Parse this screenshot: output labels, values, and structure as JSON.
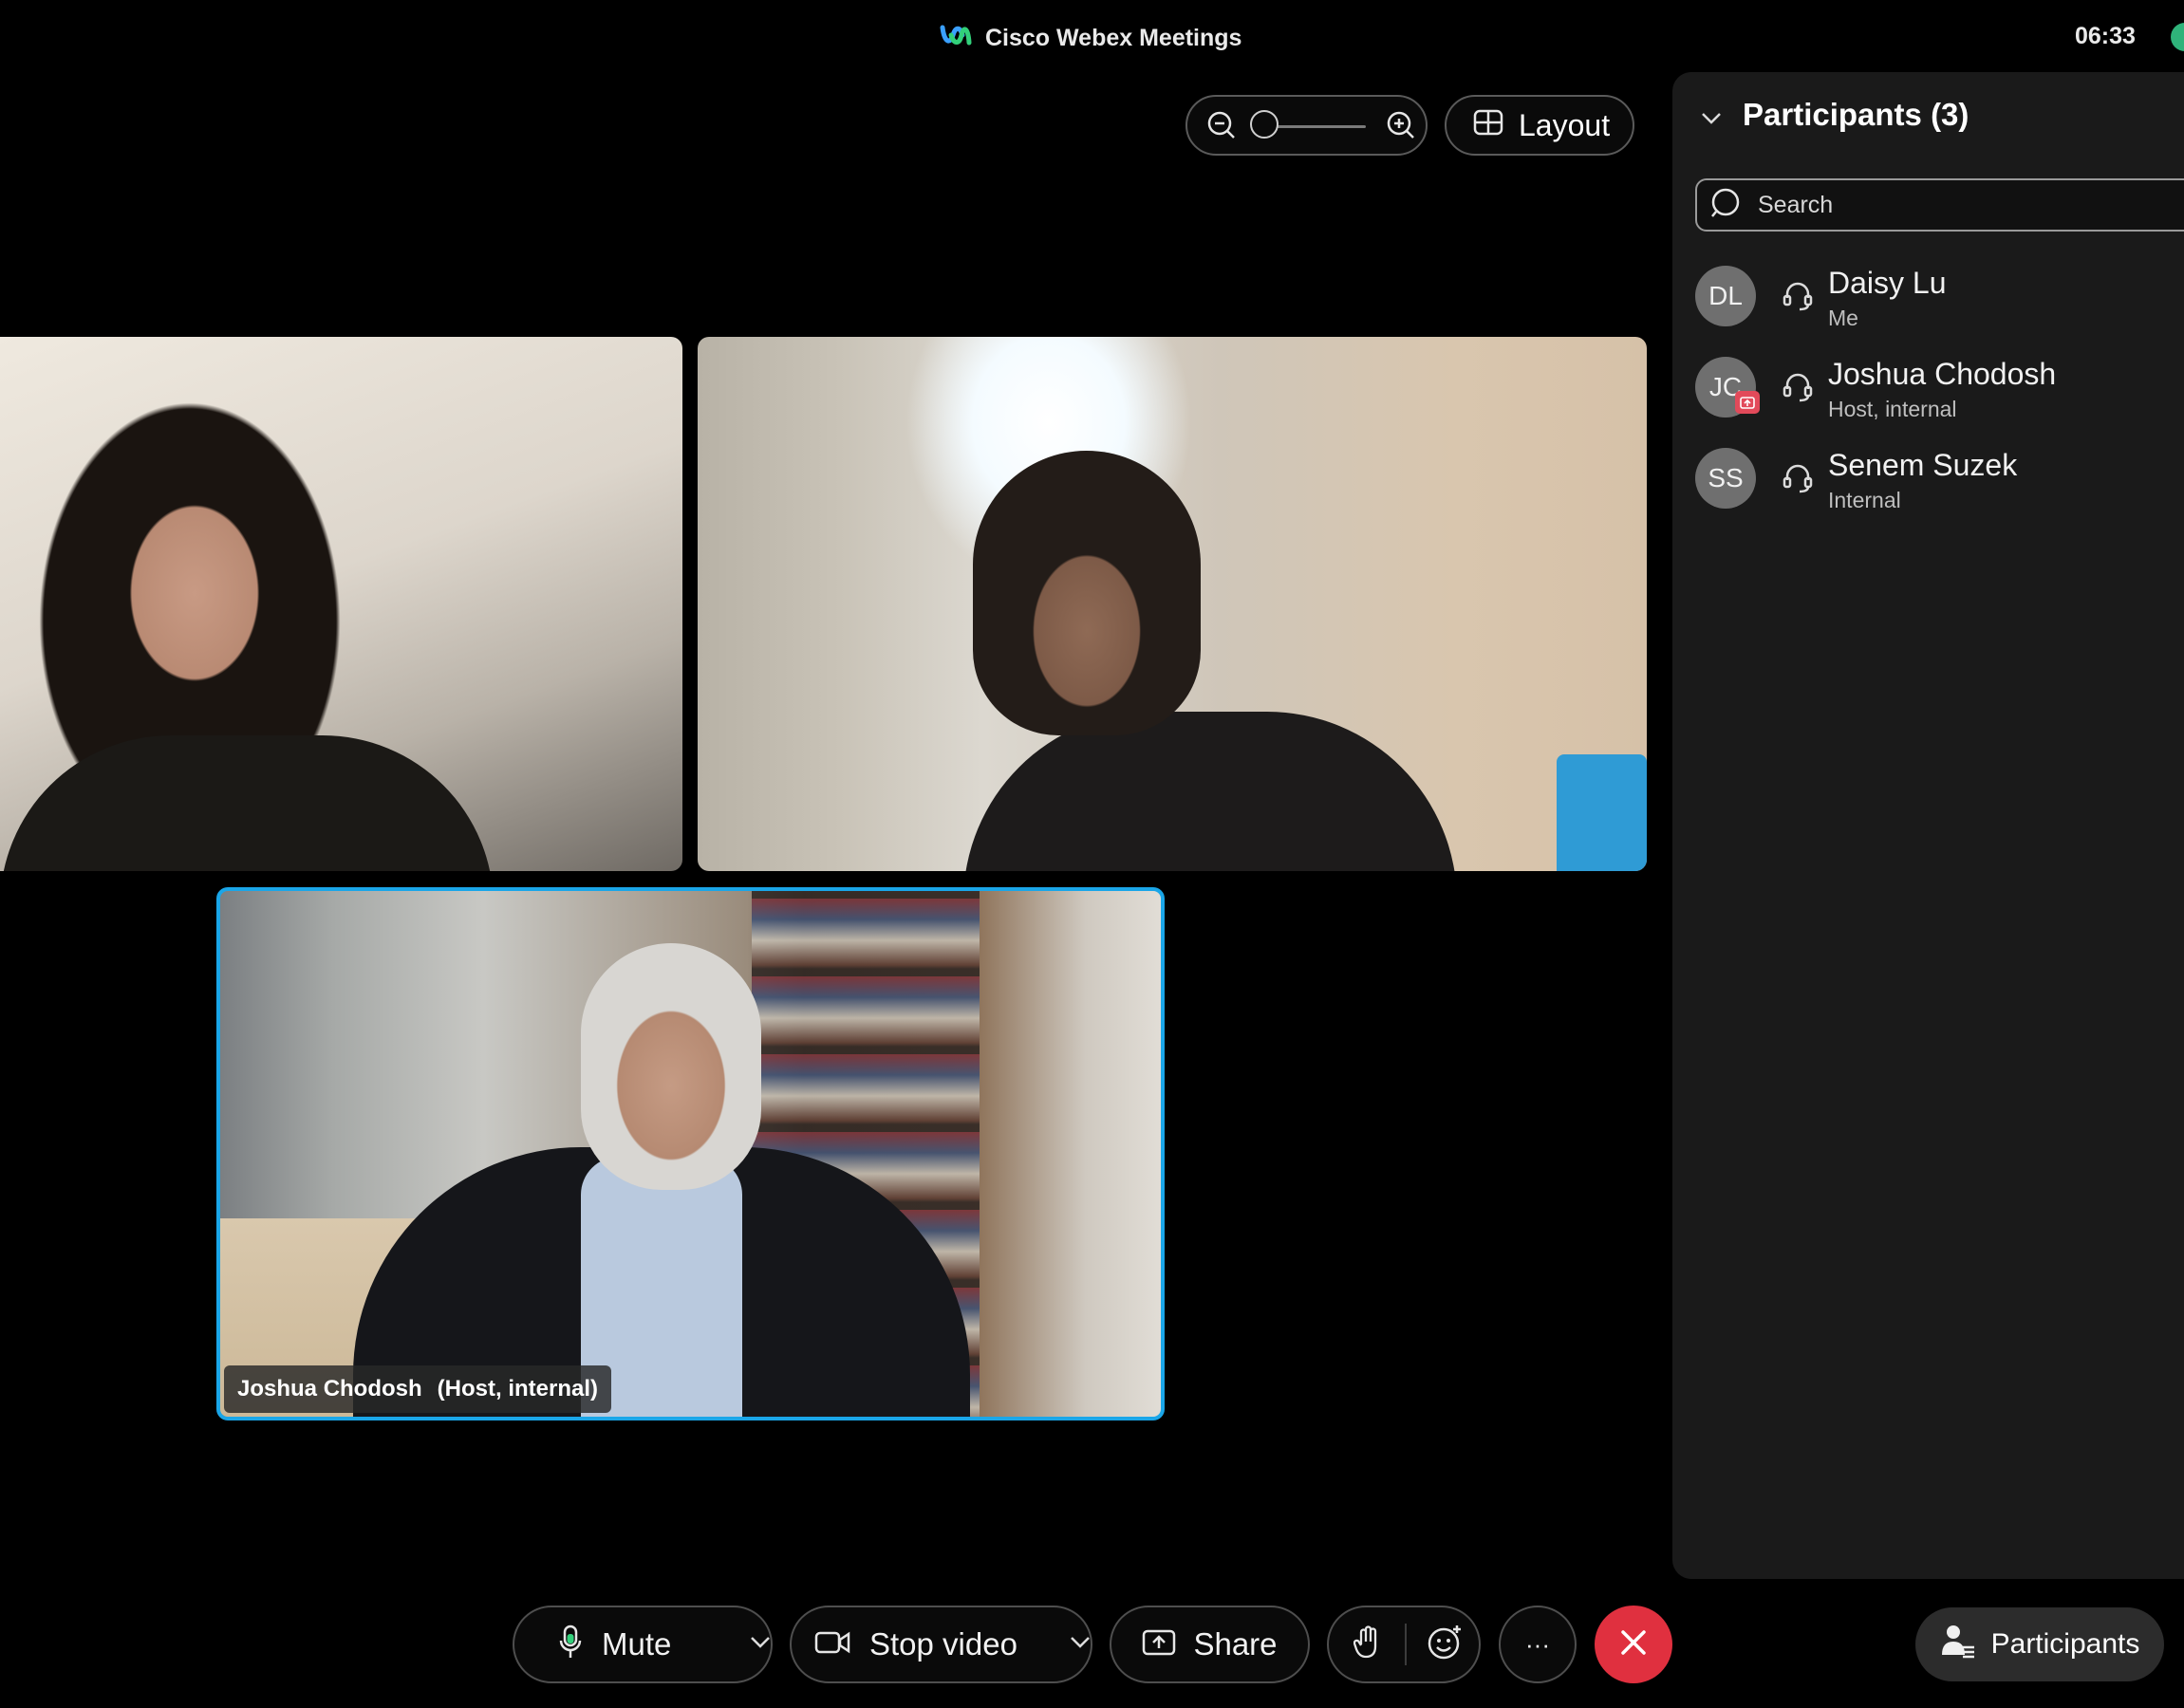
{
  "window": {
    "title": "Cisco Webex Meetings",
    "clock": "06:33"
  },
  "toolbar_top": {
    "layout_label": "Layout"
  },
  "panel": {
    "title": "Participants (3)",
    "search_placeholder": "Search",
    "participants": [
      {
        "initials": "DL",
        "name": "Daisy Lu",
        "role": "Me"
      },
      {
        "initials": "JC",
        "name": "Joshua Chodosh",
        "role": "Host, internal",
        "sharing": true
      },
      {
        "initials": "SS",
        "name": "Senem Suzek",
        "role": "Internal"
      }
    ]
  },
  "video": {
    "active_speaker_name": "Joshua Chodosh",
    "active_speaker_role": "(Host, internal)"
  },
  "controls": {
    "mute_label": "Mute",
    "stop_video_label": "Stop video",
    "share_label": "Share",
    "more_label": "···",
    "participants_label": "Participants"
  },
  "icons": {
    "app_logo": "webex-logo-icon",
    "zoom_out": "zoom-out-icon",
    "zoom_in": "zoom-in-icon",
    "layout": "grid-icon",
    "search": "search-icon",
    "headset": "headset-icon",
    "mic": "microphone-icon",
    "camera": "video-camera-icon",
    "share": "share-screen-icon",
    "raise_hand": "raise-hand-icon",
    "reactions": "smiley-icon",
    "end": "close-icon",
    "participants": "participants-icon"
  },
  "colors": {
    "accent_speaker_border": "#1aa6e8",
    "end_call": "#e0303f",
    "share_badge": "#e24a5a",
    "panel_bg": "#1a1a1a"
  }
}
